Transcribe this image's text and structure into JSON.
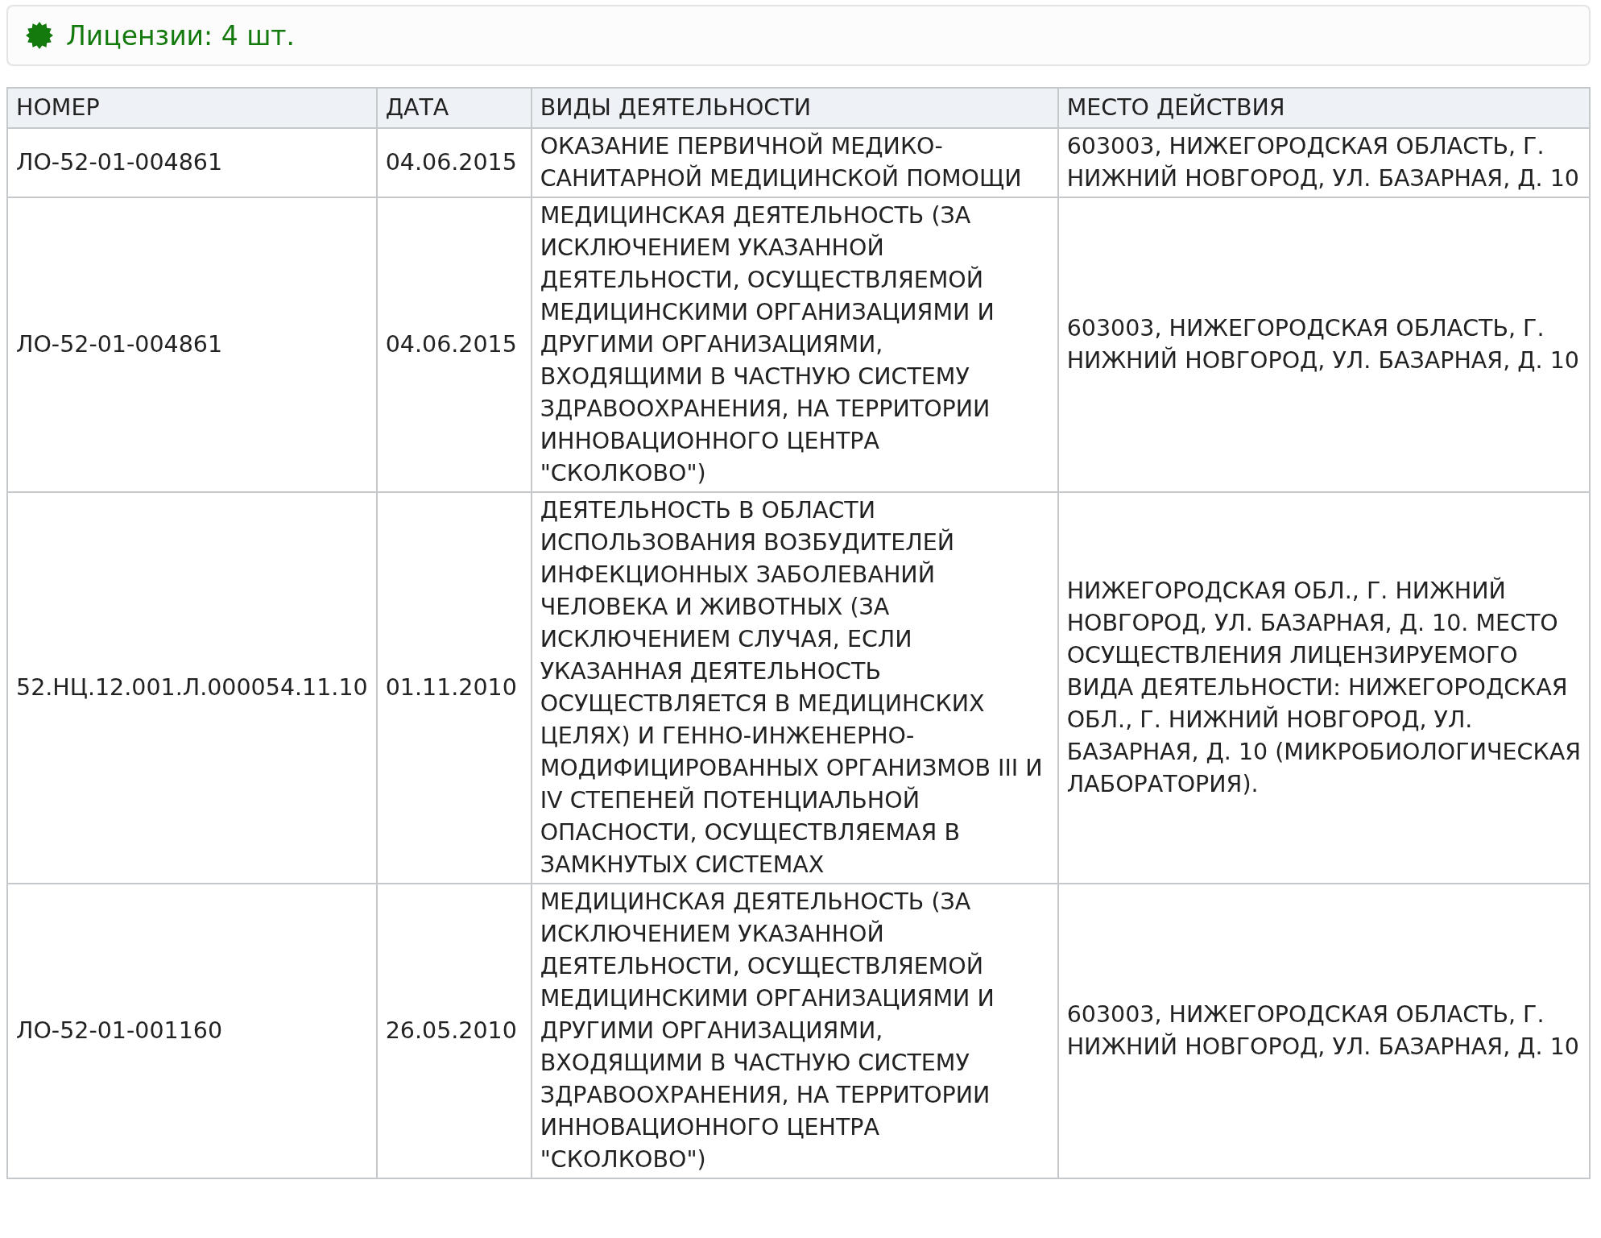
{
  "header": {
    "title": "Лицензии: 4 шт."
  },
  "table": {
    "columns": [
      "НОМЕР",
      "ДАТА",
      "ВИДЫ ДЕЯТЕЛЬНОСТИ",
      "МЕСТО ДЕЙСТВИЯ"
    ],
    "rows": [
      {
        "number": "ЛО-52-01-004861",
        "date": "04.06.2015",
        "activity": "ОКАЗАНИЕ ПЕРВИЧНОЙ МЕДИКО-САНИТАРНОЙ МЕДИЦИНСКОЙ ПОМОЩИ",
        "place": "603003, НИЖЕГОРОДСКАЯ ОБЛАСТЬ, Г. НИЖНИЙ НОВГОРОД, УЛ. БАЗАРНАЯ, Д. 10"
      },
      {
        "number": "ЛО-52-01-004861",
        "date": "04.06.2015",
        "activity": "МЕДИЦИНСКАЯ ДЕЯТЕЛЬНОСТЬ (ЗА ИСКЛЮЧЕНИЕМ УКАЗАННОЙ ДЕЯТЕЛЬНОСТИ, ОСУЩЕСТВЛЯЕМОЙ МЕДИЦИНСКИМИ ОРГАНИЗАЦИЯМИ И ДРУГИМИ ОРГАНИЗАЦИЯМИ, ВХОДЯЩИМИ В ЧАСТНУЮ СИСТЕМУ ЗДРАВООХРАНЕНИЯ, НА ТЕРРИТОРИИ ИННОВАЦИОННОГО ЦЕНТРА \"СКОЛКОВО\")",
        "place": "603003, НИЖЕГОРОДСКАЯ ОБЛАСТЬ, Г. НИЖНИЙ НОВГОРОД, УЛ. БАЗАРНАЯ, Д. 10"
      },
      {
        "number": "52.НЦ.12.001.Л.000054.11.10",
        "date": "01.11.2010",
        "activity": "ДЕЯТЕЛЬНОСТЬ В ОБЛАСТИ ИСПОЛЬЗОВАНИЯ ВОЗБУДИТЕЛЕЙ ИНФЕКЦИОННЫХ ЗАБОЛЕВАНИЙ ЧЕЛОВЕКА И ЖИВОТНЫХ (ЗА ИСКЛЮЧЕНИЕМ СЛУЧАЯ, ЕСЛИ УКАЗАННАЯ ДЕЯТЕЛЬНОСТЬ ОСУЩЕСТВЛЯЕТСЯ В МЕДИЦИНСКИХ ЦЕЛЯХ) И ГЕННО-ИНЖЕНЕРНО-МОДИФИЦИРОВАННЫХ ОРГАНИЗМОВ III И IV СТЕПЕНЕЙ ПОТЕНЦИАЛЬНОЙ ОПАСНОСТИ, ОСУЩЕСТВЛЯЕМАЯ В ЗАМКНУТЫХ СИСТЕМАХ",
        "place": "НИЖЕГОРОДСКАЯ ОБЛ., Г. НИЖНИЙ НОВГОРОД, УЛ. БАЗАРНАЯ, Д. 10. МЕСТО ОСУЩЕСТВЛЕНИЯ ЛИЦЕНЗИРУЕМОГО ВИДА ДЕЯТЕЛЬНОСТИ: НИЖЕГОРОДСКАЯ ОБЛ., Г. НИЖНИЙ НОВГОРОД, УЛ. БАЗАРНАЯ, Д. 10 (МИКРОБИОЛОГИЧЕСКАЯ ЛАБОРАТОРИЯ)."
      },
      {
        "number": "ЛО-52-01-001160",
        "date": "26.05.2010",
        "activity": "МЕДИЦИНСКАЯ ДЕЯТЕЛЬНОСТЬ (ЗА ИСКЛЮЧЕНИЕМ УКАЗАННОЙ ДЕЯТЕЛЬНОСТИ, ОСУЩЕСТВЛЯЕМОЙ МЕДИЦИНСКИМИ ОРГАНИЗАЦИЯМИ И ДРУГИМИ ОРГАНИЗАЦИЯМИ, ВХОДЯЩИМИ В ЧАСТНУЮ СИСТЕМУ ЗДРАВООХРАНЕНИЯ, НА ТЕРРИТОРИИ ИННОВАЦИОННОГО ЦЕНТРА \"СКОЛКОВО\")",
        "place": "603003, НИЖЕГОРОДСКАЯ ОБЛАСТЬ, Г. НИЖНИЙ НОВГОРОД, УЛ. БАЗАРНАЯ, Д. 10"
      }
    ]
  }
}
